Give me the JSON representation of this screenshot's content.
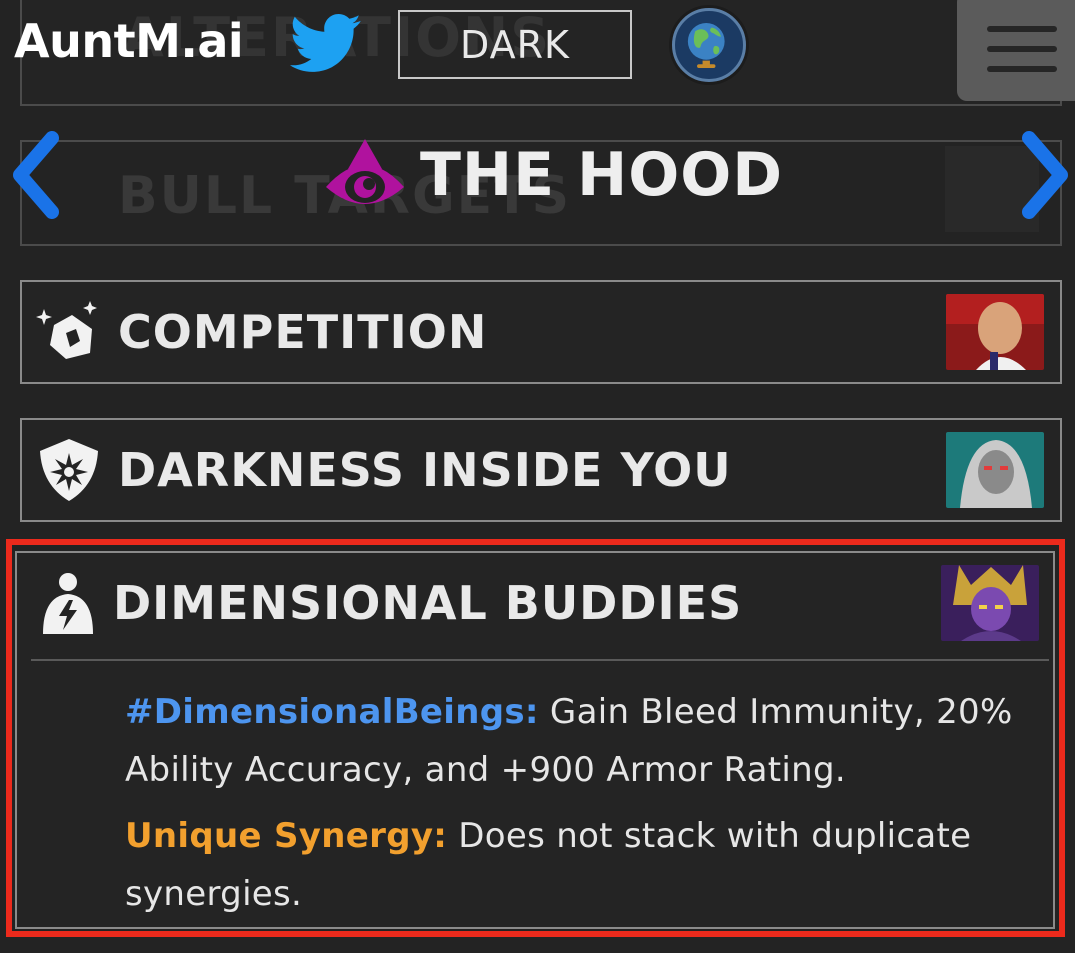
{
  "header": {
    "logo": "AuntM.ai",
    "theme_button": "DARK",
    "ghost_title": "ALTERATIONS"
  },
  "character": {
    "name": "THE HOOD",
    "ghost_title": "BULL TARGETS"
  },
  "synergies": [
    {
      "title": "COMPETITION",
      "icon": "rock-sparkle-icon",
      "portrait": "kingpin-portrait"
    },
    {
      "title": "DARKNESS INSIDE YOU",
      "icon": "shield-burst-icon",
      "portrait": "mephisto-portrait"
    },
    {
      "title": "DIMENSIONAL BUDDIES",
      "icon": "torso-lightning-icon",
      "portrait": "dimensional-being-portrait",
      "lines": [
        {
          "tag": "#DimensionalBeings:",
          "text": " Gain Bleed Immunity, 20% Ability Accuracy, and +900 Armor Rating."
        },
        {
          "tag": "Unique Synergy:",
          "text": " Does not stack with duplicate synergies."
        }
      ]
    }
  ],
  "colors": {
    "accent_blue": "#4d95ef",
    "accent_orange": "#f2a02e",
    "highlight_red": "#ec2a1c",
    "arrow_blue": "#1a73e8",
    "eye_magenta": "#b0129e"
  }
}
